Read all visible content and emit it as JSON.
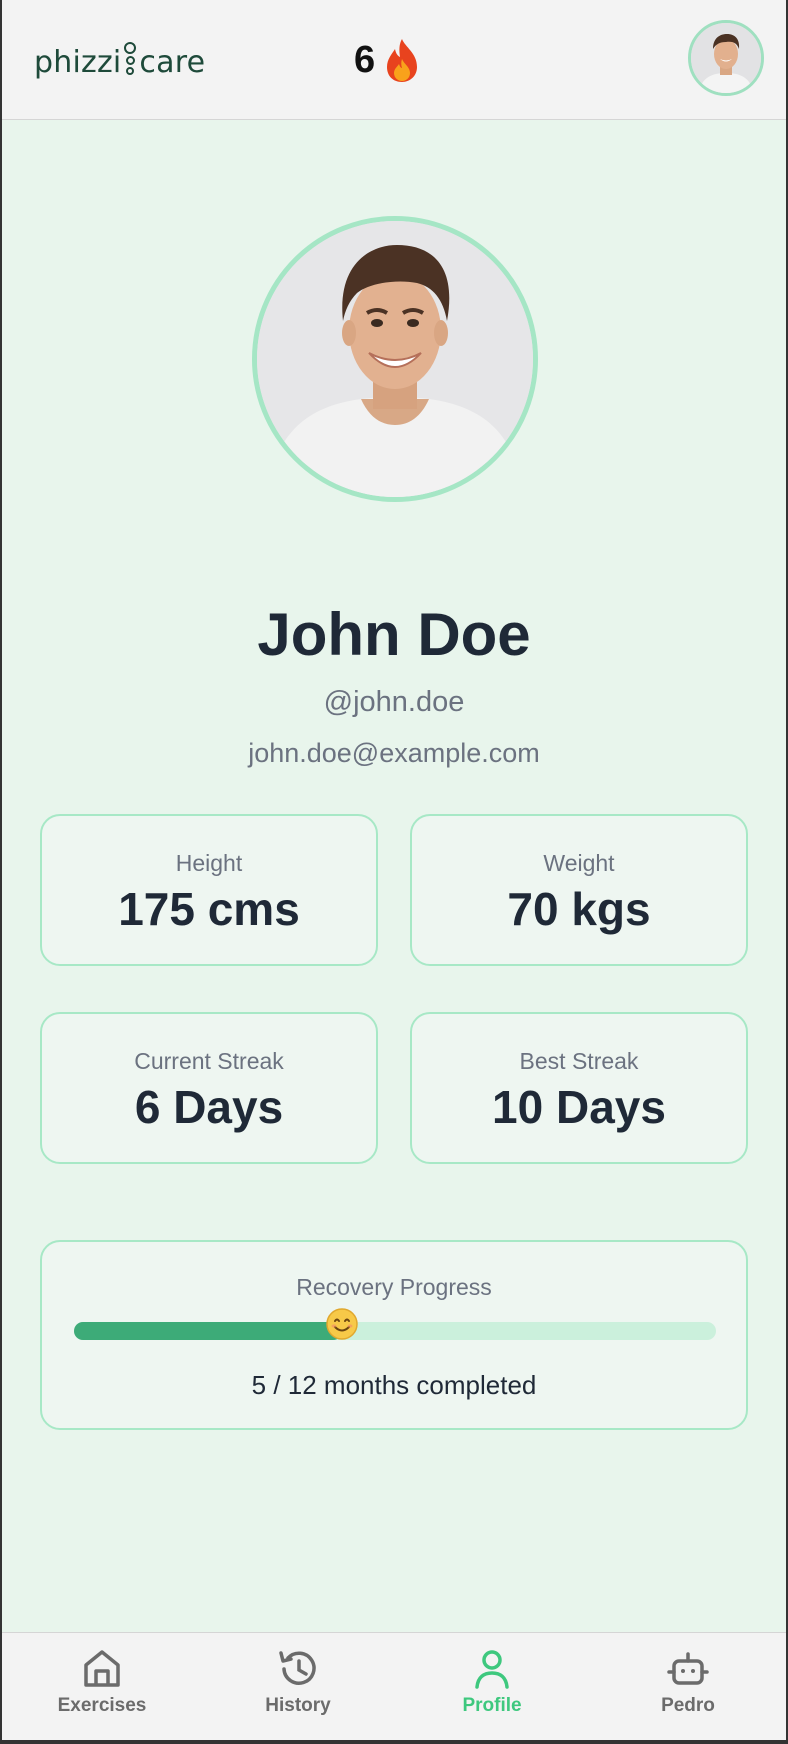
{
  "header": {
    "logo_left": "phizzi",
    "logo_right": "care",
    "streak_count": "6",
    "streak_icon": "fire-icon",
    "avatar_icon": "user-avatar"
  },
  "profile": {
    "name": "John Doe",
    "handle": "@john.doe",
    "email": "john.doe@example.com"
  },
  "stats": [
    {
      "label": "Height",
      "value": "175 cms"
    },
    {
      "label": "Weight",
      "value": "70 kgs"
    },
    {
      "label": "Current Streak",
      "value": "6 Days"
    },
    {
      "label": "Best Streak",
      "value": "10 Days"
    }
  ],
  "recovery": {
    "title": "Recovery Progress",
    "completed_months": 5,
    "total_months": 12,
    "progress_text": "5 / 12 months completed",
    "thumb_icon": "smiley-face-icon"
  },
  "nav": {
    "items": [
      {
        "label": "Exercises",
        "icon": "home-icon",
        "active": false
      },
      {
        "label": "History",
        "icon": "history-icon",
        "active": false
      },
      {
        "label": "Profile",
        "icon": "user-icon",
        "active": true
      },
      {
        "label": "Pedro",
        "icon": "robot-icon",
        "active": false
      }
    ]
  },
  "colors": {
    "accent": "#3ec87e",
    "progress_fill": "#3dab78",
    "background": "#e8f5ec",
    "card_border": "#a7e8c6"
  }
}
